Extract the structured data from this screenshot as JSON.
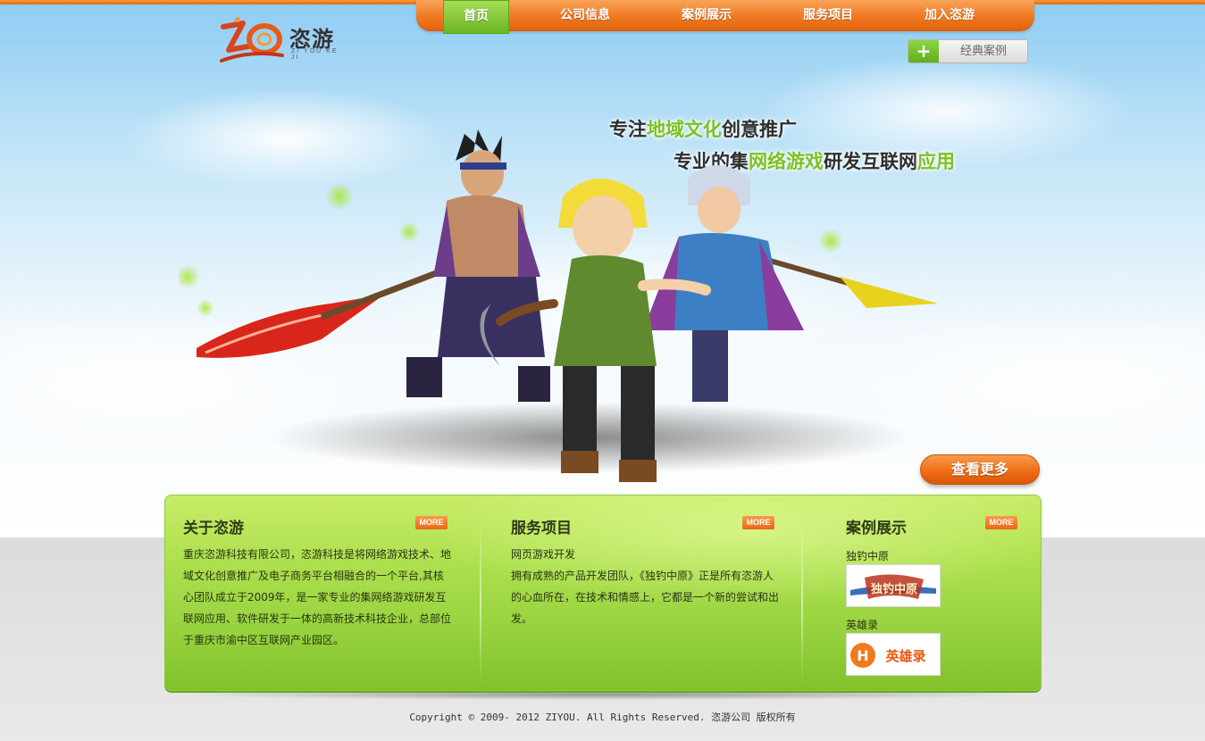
{
  "brand": {
    "logo_name": "恣游",
    "logo_sub": "ZI YOU KE JI"
  },
  "nav": {
    "items": [
      "首页",
      "公司信息",
      "案例展示",
      "服务项目",
      "加入恣游"
    ],
    "active_index": 0
  },
  "classic_button": {
    "label": "经典案例"
  },
  "slogans": {
    "line1": {
      "before": "专注",
      "highlight": "地域文化",
      "after": "创意推广"
    },
    "line2": {
      "before": "专业的集",
      "highlight": "网络游戏",
      "middle": "研发互联网",
      "highlight2": "应用"
    }
  },
  "view_more": {
    "label": "查看更多"
  },
  "sections": {
    "about": {
      "title": "关于恣游",
      "more": "MORE",
      "text": "重庆恣游科技有限公司，恣游科技是将网络游戏技术、地域文化创意推广及电子商务平台相融合的一个平台,其核心团队成立于2009年，是一家专业的集网络游戏研发互联网应用、软件研发于一体的高新技术科技企业，总部位于重庆市渝中区互联网产业园区。"
    },
    "services": {
      "title": "服务项目",
      "more": "MORE",
      "subtitle": "网页游戏开发",
      "text": "拥有成熟的产品开发团队，《独钓中原》正是所有恣游人的心血所在，在技术和情感上，它都是一个新的尝试和出发。"
    },
    "cases": {
      "title": "案例展示",
      "more": "MORE",
      "items": [
        {
          "name": "独钓中原",
          "thumb_text": "独钓中原"
        },
        {
          "name": "英雄录",
          "thumb_text": "英雄录",
          "thumb_badge": "H"
        }
      ]
    }
  },
  "footer": {
    "text": "Copyright © 2009- 2012 ZIYOU. All Rights Reserved. 恣游公司 版权所有"
  },
  "colors": {
    "orange": "#ee6a12",
    "green": "#96d23d",
    "green_highlight": "#7dc123"
  }
}
